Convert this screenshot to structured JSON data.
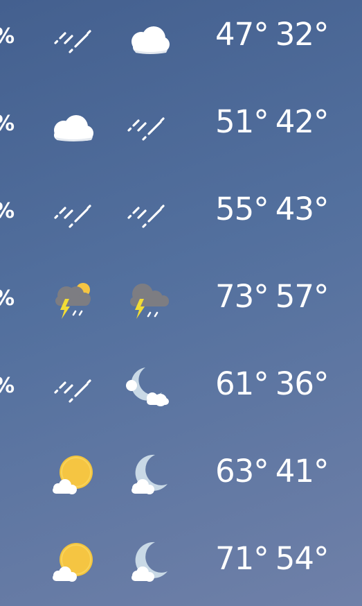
{
  "forecast": {
    "rows": [
      {
        "precip": "%",
        "day_icon": "rain-icon",
        "night_icon": "cloud-icon",
        "high": "47°",
        "low": "32°"
      },
      {
        "precip": "%",
        "day_icon": "cloud-icon",
        "night_icon": "rain-icon",
        "high": "51°",
        "low": "42°"
      },
      {
        "precip": "%",
        "day_icon": "rain-icon",
        "night_icon": "rain-icon",
        "high": "55°",
        "low": "43°"
      },
      {
        "precip": "%",
        "day_icon": "thunderstorm-sun-icon",
        "night_icon": "thunderstorm-icon",
        "high": "73°",
        "low": "57°"
      },
      {
        "precip": "%",
        "day_icon": "rain-icon",
        "night_icon": "moon-cloud-icon",
        "high": "61°",
        "low": "36°"
      },
      {
        "precip": "",
        "day_icon": "sun-cloud-icon",
        "night_icon": "moon-cloud-icon",
        "high": "63°",
        "low": "41°"
      },
      {
        "precip": "",
        "day_icon": "sun-cloud-icon",
        "night_icon": "moon-cloud-icon",
        "high": "71°",
        "low": "54°"
      }
    ]
  },
  "colors": {
    "background_top": "#44608f",
    "background_bottom": "#6f80a8",
    "text": "#ffffff",
    "sun": "#f5c542",
    "moon": "#c9d9e6",
    "storm_cloud": "#7d7d82",
    "lightning": "#f2dc35"
  }
}
